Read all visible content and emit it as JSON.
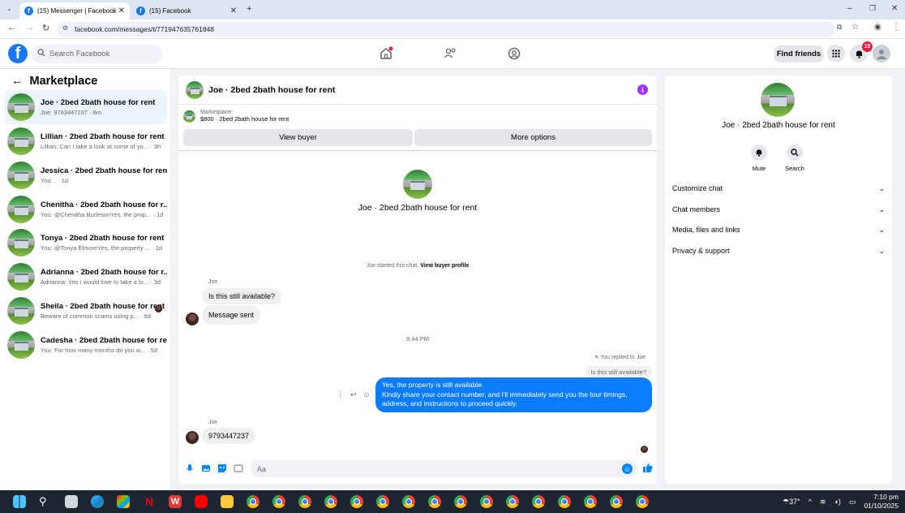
{
  "browser": {
    "tabs": [
      {
        "title": "(15) Messenger | Facebook",
        "active": true
      },
      {
        "title": "(15) Facebook",
        "active": false
      }
    ],
    "url": "facebook.com/messages/t/771947635761848"
  },
  "header": {
    "search_placeholder": "Search Facebook",
    "find_friends": "Find friends",
    "notification_count": "15"
  },
  "sidebar": {
    "title": "Marketplace",
    "conversations": [
      {
        "name": "Joe · 2bed 2bath house for rent",
        "preview": "Joe: 9793447237 · 8m"
      },
      {
        "name": "Lillian · 2bed 2bath house for rent",
        "preview": "Lillian: Can I take a look at some of yo... · 3h"
      },
      {
        "name": "Jessica · 2bed 2bath house for rent",
        "preview": "You: . · 1d"
      },
      {
        "name": "Chenitha · 2bed 2bath house for r...",
        "preview": "You: @Chenitha BurlesonYes, the prop... · 1d"
      },
      {
        "name": "Tonya · 2bed 2bath house for rent",
        "preview": "You: @Tonya ElmoreYes, the property ... · 1d"
      },
      {
        "name": "Adrianna · 2bed 2bath house for r...",
        "preview": "Adrianna: Yes I would love to take a lo... · 3d"
      },
      {
        "name": "Sheila · 2bed 2bath house for rent",
        "preview": "Beware of common scams using p... · 5d"
      },
      {
        "name": "Cadesha · 2bed 2bath house for rent",
        "preview": "You: For how many months do you w... · 5d"
      }
    ]
  },
  "chat": {
    "title": "Joe · 2bed 2bath house for rent",
    "marketplace_label": "Marketplace",
    "listing": "$800 · 2bed 2bath house for rent",
    "view_buyer": "View buyer",
    "more_options": "More options",
    "center_name": "Joe · 2bed 2bath house for rent",
    "started_text": "Joe started this chat.",
    "view_buyer_profile": "View buyer profile",
    "sender1": "Joe",
    "msg1": "Is this still available?",
    "msg2": "Message sent",
    "timestamp": "9:44 PM",
    "replied_to": "You replied to Joe",
    "quoted": "Is this still available?",
    "reply_line1": "Yes, the property is still available.",
    "reply_line2": "Kindly share your contact number, and I'll immediately send you the tour timings,",
    "reply_line3": "address, and instructions to proceed quickly.",
    "sender2": "Joe",
    "msg3": "9793447237",
    "input_placeholder": "Aa"
  },
  "details": {
    "name": "Joe · 2bed 2bath house for rent",
    "mute": "Mute",
    "search": "Search",
    "sections": [
      "Customize chat",
      "Chat members",
      "Media, files and links",
      "Privacy & support"
    ]
  },
  "taskbar": {
    "temperature": "37°",
    "time": "7:10 pm",
    "date": "01/10/2025"
  }
}
